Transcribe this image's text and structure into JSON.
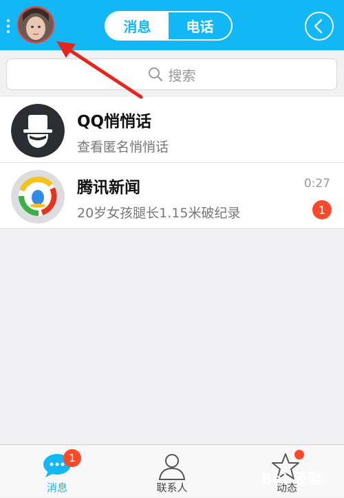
{
  "header": {
    "tabs": [
      {
        "label": "消息",
        "active": true
      },
      {
        "label": "电话",
        "active": false
      }
    ],
    "accent_color": "#12b7f5"
  },
  "search": {
    "placeholder": "搜索"
  },
  "conversations": [
    {
      "title": "QQ悄悄话",
      "subtitle": "查看匿名悄悄话",
      "time": "",
      "badge": ""
    },
    {
      "title": "腾讯新闻",
      "subtitle": "20岁女孩腿长1.15米破纪录",
      "time": "0:27",
      "badge": "1"
    }
  ],
  "tabbar": {
    "items": [
      {
        "label": "消息",
        "icon": "chat-bubble-icon",
        "badge": "1",
        "active": true
      },
      {
        "label": "联系人",
        "icon": "person-icon",
        "active": false
      },
      {
        "label": "动态",
        "icon": "star-icon",
        "dot": true,
        "active": false
      }
    ]
  },
  "watermark": "Bai 经验"
}
